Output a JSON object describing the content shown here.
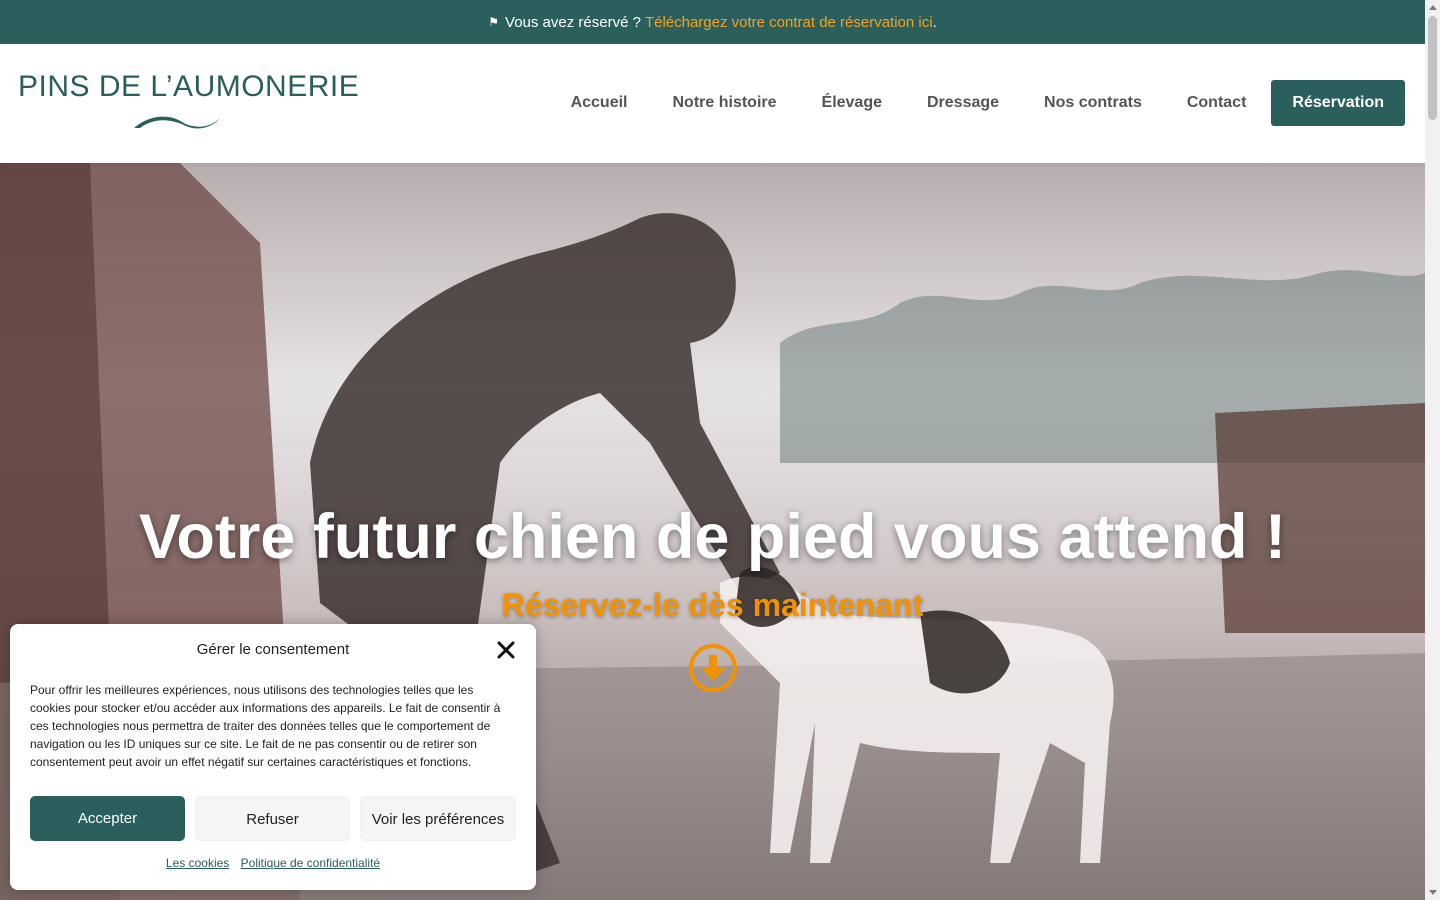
{
  "topbar": {
    "icon": "flag-icon",
    "text": "Vous avez réservé ?",
    "link": "Téléchargez votre contrat de réservation ici",
    "suffix": ".",
    "link_color": "#f5a21b",
    "bg_color": "#2a5f5e"
  },
  "header": {
    "logo_text": "PINS DE L’AUMONERIE",
    "nav": [
      "Accueil",
      "Notre histoire",
      "Élevage",
      "Dressage",
      "Nos contrats",
      "Contact"
    ],
    "cta": "Réservation",
    "brand_color": "#2a5f5e"
  },
  "hero": {
    "title": "Votre futur chien de pied vous attend !",
    "subtitle": "Réservez-le dès maintenant",
    "accent_color": "#f39200",
    "arrow_icon": "arrow-down-circle-icon"
  },
  "consent": {
    "title": "Gérer le consentement",
    "text": "Pour offrir les meilleures expériences, nous utilisons des technologies telles que les cookies pour stocker et/ou accéder aux informations des appareils. Le fait de consentir à ces technologies nous permettra de traiter des données telles que le comportement de navigation ou les ID uniques sur ce site. Le fait de ne pas consentir ou de retirer son consentement peut avoir un effet négatif sur certaines caractéristiques et fonctions.",
    "accept": "Accepter",
    "refuse": "Refuser",
    "preferences": "Voir les préférences",
    "link_cookies": "Les cookies",
    "link_privacy": "Politique de confidentialité"
  }
}
